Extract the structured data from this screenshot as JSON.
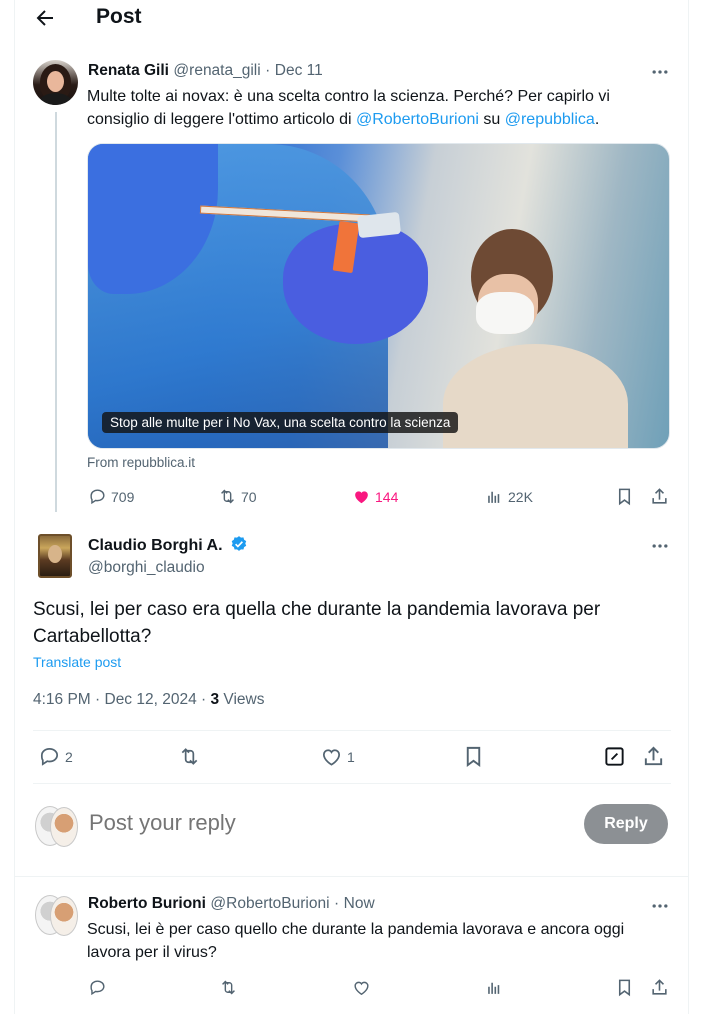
{
  "header": {
    "title": "Post",
    "back_icon": "arrow-left-icon"
  },
  "parent_tweet": {
    "author_name": "Renata Gili",
    "handle": "@renata_gili",
    "separator": "·",
    "date": "Dec 11",
    "text_part1": "Multe tolte ai novax: è una scelta contro la scienza. Perché? Per capirlo vi consiglio di leggere l'ottimo articolo di ",
    "mention1": "@RobertoBurioni",
    "text_part2": " su ",
    "mention2": "@repubblica",
    "text_part3": ".",
    "card_caption": "Stop alle multe per i No Vax, una scelta contro la scienza",
    "card_source": "From repubblica.it",
    "stats": {
      "replies": "709",
      "reposts": "70",
      "likes": "144",
      "views": "22K"
    }
  },
  "main_tweet": {
    "author_name": "Claudio Borghi A.",
    "handle": "@borghi_claudio",
    "text": "Scusi, lei per caso era quella che durante la pandemia lavorava per Cartabellotta?",
    "translate_label": "Translate post",
    "timestamp": "4:16 PM · Dec 12, 2024 · ",
    "views_count": "3",
    "views_label": " Views",
    "stats": {
      "replies": "2",
      "likes": "1"
    }
  },
  "composer": {
    "placeholder": "Post your reply",
    "button_label": "Reply"
  },
  "reply_tweet": {
    "author_name": "Roberto Burioni",
    "handle": "@RobertoBurioni",
    "separator": "·",
    "time": "Now",
    "text": "Scusi, lei è per caso quello che durante la pandemia lavorava e ancora oggi lavora per il virus?"
  },
  "colors": {
    "accent": "#1d9bf0",
    "like": "#f91880",
    "text": "#0f1419",
    "muted": "#536471",
    "reply_button": "#8c9094"
  }
}
